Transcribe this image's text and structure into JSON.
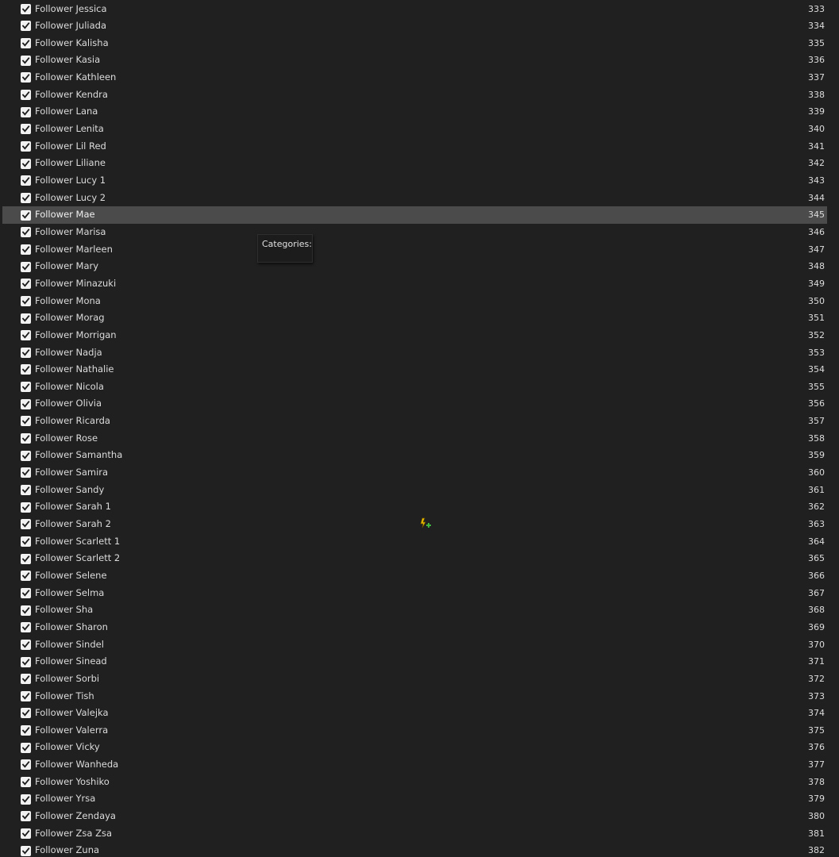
{
  "mod_list": {
    "selected_priority": "345",
    "rows": [
      {
        "name": "Follower Jessica",
        "priority": "333",
        "checked": true
      },
      {
        "name": "Follower Juliada",
        "priority": "334",
        "checked": true
      },
      {
        "name": "Follower Kalisha",
        "priority": "335",
        "checked": true
      },
      {
        "name": "Follower Kasia",
        "priority": "336",
        "checked": true
      },
      {
        "name": "Follower Kathleen",
        "priority": "337",
        "checked": true
      },
      {
        "name": "Follower Kendra",
        "priority": "338",
        "checked": true
      },
      {
        "name": "Follower Lana",
        "priority": "339",
        "checked": true
      },
      {
        "name": "Follower Lenita",
        "priority": "340",
        "checked": true
      },
      {
        "name": "Follower Lil Red",
        "priority": "341",
        "checked": true
      },
      {
        "name": "Follower Liliane",
        "priority": "342",
        "checked": true
      },
      {
        "name": "Follower Lucy 1",
        "priority": "343",
        "checked": true
      },
      {
        "name": "Follower Lucy 2",
        "priority": "344",
        "checked": true
      },
      {
        "name": "Follower Mae",
        "priority": "345",
        "checked": true
      },
      {
        "name": "Follower Marisa",
        "priority": "346",
        "checked": true
      },
      {
        "name": "Follower Marleen",
        "priority": "347",
        "checked": true
      },
      {
        "name": "Follower Mary",
        "priority": "348",
        "checked": true
      },
      {
        "name": "Follower Minazuki",
        "priority": "349",
        "checked": true
      },
      {
        "name": "Follower Mona",
        "priority": "350",
        "checked": true
      },
      {
        "name": "Follower Morag",
        "priority": "351",
        "checked": true
      },
      {
        "name": "Follower Morrigan",
        "priority": "352",
        "checked": true
      },
      {
        "name": "Follower Nadja",
        "priority": "353",
        "checked": true
      },
      {
        "name": "Follower Nathalie",
        "priority": "354",
        "checked": true
      },
      {
        "name": "Follower Nicola",
        "priority": "355",
        "checked": true
      },
      {
        "name": "Follower Olivia",
        "priority": "356",
        "checked": true
      },
      {
        "name": "Follower Ricarda",
        "priority": "357",
        "checked": true
      },
      {
        "name": "Follower Rose",
        "priority": "358",
        "checked": true
      },
      {
        "name": "Follower Samantha",
        "priority": "359",
        "checked": true
      },
      {
        "name": "Follower Samira",
        "priority": "360",
        "checked": true
      },
      {
        "name": "Follower Sandy",
        "priority": "361",
        "checked": true
      },
      {
        "name": "Follower Sarah 1",
        "priority": "362",
        "checked": true
      },
      {
        "name": "Follower Sarah 2",
        "priority": "363",
        "checked": true
      },
      {
        "name": "Follower Scarlett 1",
        "priority": "364",
        "checked": true
      },
      {
        "name": "Follower Scarlett 2",
        "priority": "365",
        "checked": true
      },
      {
        "name": "Follower Selene",
        "priority": "366",
        "checked": true
      },
      {
        "name": "Follower Selma",
        "priority": "367",
        "checked": true
      },
      {
        "name": "Follower Sha",
        "priority": "368",
        "checked": true
      },
      {
        "name": "Follower Sharon",
        "priority": "369",
        "checked": true
      },
      {
        "name": "Follower Sindel",
        "priority": "370",
        "checked": true
      },
      {
        "name": "Follower Sinead",
        "priority": "371",
        "checked": true
      },
      {
        "name": "Follower Sorbi",
        "priority": "372",
        "checked": true
      },
      {
        "name": "Follower Tish",
        "priority": "373",
        "checked": true
      },
      {
        "name": "Follower Valejka",
        "priority": "374",
        "checked": true
      },
      {
        "name": "Follower Valerra",
        "priority": "375",
        "checked": true
      },
      {
        "name": "Follower Vicky",
        "priority": "376",
        "checked": true
      },
      {
        "name": "Follower Wanheda",
        "priority": "377",
        "checked": true
      },
      {
        "name": "Follower Yoshiko",
        "priority": "378",
        "checked": true
      },
      {
        "name": "Follower Yrsa",
        "priority": "379",
        "checked": true
      },
      {
        "name": "Follower Zendaya",
        "priority": "380",
        "checked": true
      },
      {
        "name": "Follower Zsa Zsa",
        "priority": "381",
        "checked": true
      },
      {
        "name": "Follower Zuna",
        "priority": "382",
        "checked": true
      }
    ]
  },
  "tooltip": {
    "label": "Categories:"
  },
  "cursor": {
    "icon": "drag-add-cursor-icon"
  },
  "colors": {
    "background": "#202020",
    "selected_row": "#4b4b4b",
    "text": "#dcdcdc",
    "checkbox": "#f2f2f2",
    "checkmark": "#1a1a1a",
    "cursor_accent": "#f2c200"
  }
}
